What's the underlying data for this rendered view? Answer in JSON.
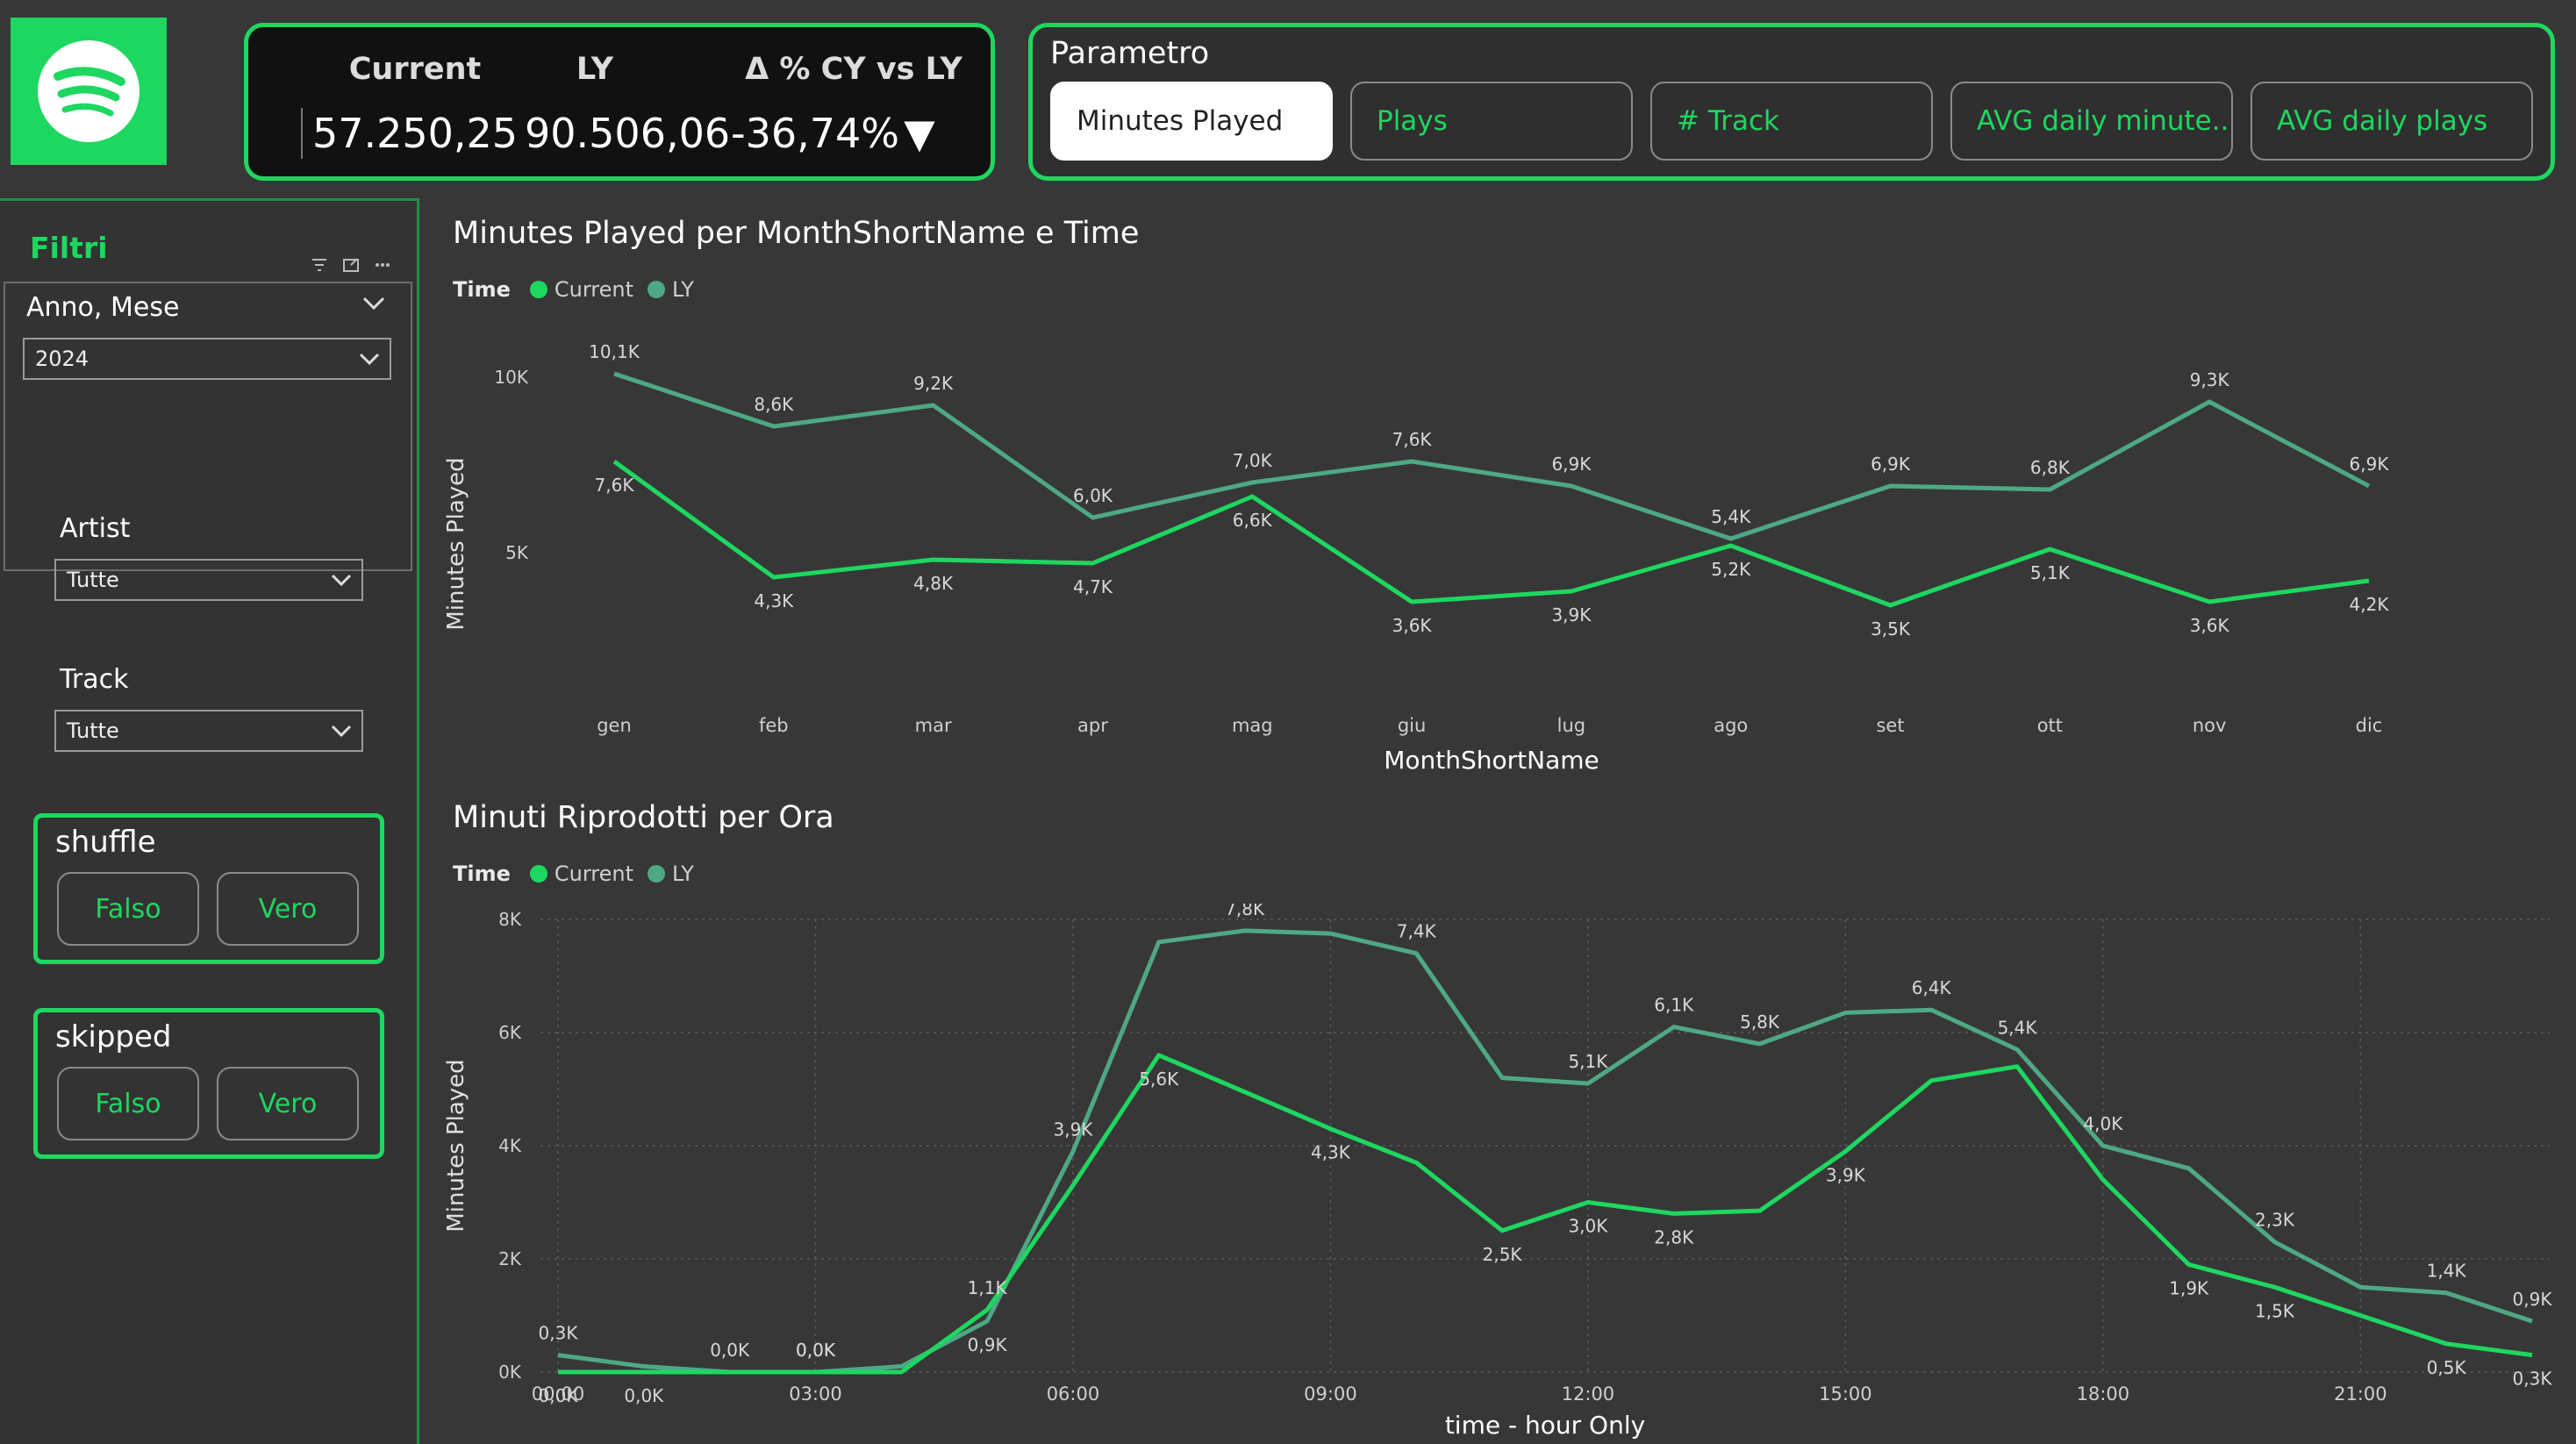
{
  "kpi": {
    "headers": [
      "Current",
      "LY",
      "Δ % CY vs LY"
    ],
    "current": "57.250,25",
    "ly": "90.506,06",
    "delta": "-36,74%",
    "delta_arrow": "▼"
  },
  "parametro": {
    "title": "Parametro",
    "options": [
      "Minutes Played",
      "Plays",
      "# Track",
      "AVG daily minute...",
      "AVG daily plays"
    ],
    "selected": "Minutes Played"
  },
  "filters": {
    "title": "Filtri",
    "anno_mese_label": "Anno, Mese",
    "anno_mese_value": "2024",
    "artist_label": "Artist",
    "artist_value": "Tutte",
    "track_label": "Track",
    "track_value": "Tutte",
    "shuffle": {
      "title": "shuffle",
      "options": [
        "Falso",
        "Vero"
      ]
    },
    "skipped": {
      "title": "skipped",
      "options": [
        "Falso",
        "Vero"
      ]
    }
  },
  "colors": {
    "accent": "#1ed760",
    "current": "#1ed760",
    "ly": "#4ea884",
    "background": "#373737"
  },
  "icons": [
    "spotify-logo-icon",
    "filter-icon",
    "focus-mode-icon",
    "more-options-icon",
    "chevron-down-icon",
    "sort-down-triangle-icon"
  ],
  "chart_data": [
    {
      "type": "line",
      "title": "Minutes Played per MonthShortName e Time",
      "legend_title": "Time",
      "legend_placement": "top-left",
      "xlabel": "MonthShortName",
      "ylabel": "Minutes Played",
      "categories": [
        "gen",
        "feb",
        "mar",
        "apr",
        "mag",
        "giu",
        "lug",
        "ago",
        "set",
        "ott",
        "nov",
        "dic"
      ],
      "y_ticks": [
        "10K",
        "5K"
      ],
      "ylim": [
        0,
        10500
      ],
      "grid": false,
      "series": [
        {
          "name": "Current",
          "values": [
            7600,
            4300,
            4800,
            4700,
            6600,
            3600,
            3900,
            5200,
            3500,
            5100,
            3600,
            4200
          ],
          "labels": [
            "7,6K",
            "4,3K",
            "4,8K",
            "4,7K",
            "6,6K",
            "3,6K",
            "3,9K",
            "5,2K",
            "3,5K",
            "5,1K",
            "3,6K",
            "4,2K"
          ]
        },
        {
          "name": "LY",
          "values": [
            10100,
            8600,
            9200,
            6000,
            7000,
            7600,
            6900,
            5400,
            6900,
            6800,
            9300,
            6900
          ],
          "labels": [
            "10,1K",
            "8,6K",
            "9,2K",
            "6,0K",
            "7,0K",
            "7,6K",
            "6,9K",
            "5,4K",
            "6,9K",
            "6,8K",
            "9,3K",
            "6,9K"
          ]
        }
      ]
    },
    {
      "type": "line",
      "title": "Minuti Riprodotti per Ora",
      "legend_title": "Time",
      "legend_placement": "top-left",
      "xlabel": "time - hour Only",
      "ylabel": "Minutes Played",
      "x": [
        0,
        1,
        2,
        3,
        4,
        5,
        6,
        7,
        8,
        9,
        10,
        11,
        12,
        13,
        14,
        15,
        16,
        17,
        18,
        19,
        20,
        21,
        22,
        23
      ],
      "x_ticks": [
        "00:00",
        "03:00",
        "06:00",
        "09:00",
        "12:00",
        "15:00",
        "18:00",
        "21:00"
      ],
      "y_ticks": [
        "0K",
        "2K",
        "4K",
        "6K",
        "8K"
      ],
      "ylim": [
        0,
        8000
      ],
      "grid": true,
      "series": [
        {
          "name": "Current",
          "values": [
            0,
            0,
            0,
            0,
            0,
            1100,
            3300,
            5600,
            4950,
            4300,
            3700,
            2500,
            3000,
            2800,
            2850,
            3900,
            5150,
            5400,
            3400,
            1900,
            1500,
            1000,
            500,
            300
          ],
          "labels": [
            "0,0K",
            "0,0K",
            "0,0K",
            "0,0K",
            "",
            "1,1K",
            "",
            "5,6K",
            "",
            "4,3K",
            "",
            "2,5K",
            "3,0K",
            "2,8K",
            "",
            "3,9K",
            "",
            "",
            "",
            "1,9K",
            "1,5K",
            "",
            "0,5K",
            "0,3K"
          ]
        },
        {
          "name": "LY",
          "values": [
            300,
            100,
            0,
            0,
            100,
            900,
            3900,
            7600,
            7800,
            7750,
            7400,
            5200,
            5100,
            6100,
            5800,
            6350,
            6400,
            5700,
            4000,
            3600,
            2300,
            1500,
            1400,
            900
          ],
          "labels": [
            "0,3K",
            "",
            "",
            "0,0K",
            "",
            "0,9K",
            "3,9K",
            "",
            "7,8K",
            "",
            "7,4K",
            "",
            "5,1K",
            "6,1K",
            "5,8K",
            "",
            "6,4K",
            "5,4K",
            "4,0K",
            "",
            "2,3K",
            "",
            "1,4K",
            "0,9K"
          ]
        }
      ]
    }
  ]
}
